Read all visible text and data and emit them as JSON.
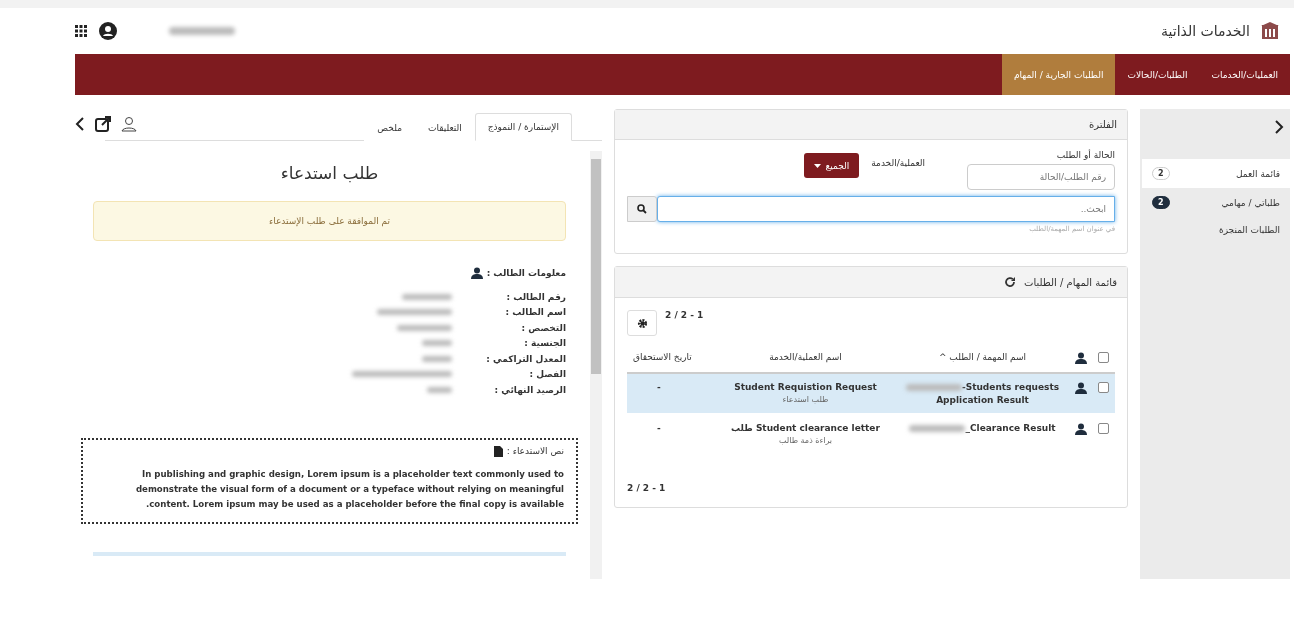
{
  "header": {
    "title": "الخدمات الذاتية"
  },
  "nav": [
    {
      "label": "العمليات/الخدمات",
      "selected": false
    },
    {
      "label": "الطلبات/الحالات",
      "selected": false
    },
    {
      "label": "الطلبات الجارية / المهام",
      "selected": true
    }
  ],
  "sidebar": {
    "items": [
      {
        "label": "قائمة العمل",
        "badge": "2",
        "selected": true
      },
      {
        "label": "طلباتي / مهامي",
        "badge": "2",
        "selected": false
      },
      {
        "label": "الطلبات المنجزة",
        "selected": false
      }
    ]
  },
  "filter": {
    "title": "الفلترة",
    "case_label": "الحالة أو الطلب",
    "case_placeholder": "رقم الطلب/الحالة",
    "service_label": "العملية/الخدمة",
    "service_value": "الجميع",
    "search_placeholder": "ابحث..",
    "search_hint": "في عنوان اسم المهمة/الطلب"
  },
  "tasks": {
    "title": "قائمة المهام / الطلبات",
    "pagination_top": "2 / 2 - 1",
    "pagination_bottom": "2 / 2 - 1",
    "select_all_checked": false,
    "columns": [
      "اسم المهمة / الطلب ^",
      "اسم العملية/الخدمة",
      "تاريخ الاستحقاق"
    ],
    "rows": [
      {
        "checked": false,
        "selected": true,
        "task": "Students requests-",
        "task_line2": "Application Result",
        "service": "Student Requistion Request",
        "service_sub": "طلب استدعاء",
        "due": "-"
      },
      {
        "checked": false,
        "selected": false,
        "task": "Clearance Result_",
        "service": "Student clearance letter طلب",
        "service_sub": "براءة ذمة طالب",
        "due": "-"
      }
    ]
  },
  "detail": {
    "tabs": [
      {
        "label": "الإستمارة / النموذج",
        "selected": true
      },
      {
        "label": "التعليقات",
        "selected": false
      },
      {
        "label": "ملخص",
        "selected": false
      }
    ],
    "title": "طلب استدعاء",
    "alert": "تم الموافقة على طلب الإستدعاء",
    "info_title": "معلومات الطالب :",
    "fields": [
      "رقم الطالب :",
      "اسم الطالب :",
      "التخصص :",
      "الجنسية :",
      "المعدل التراكمي :",
      "الفصل :",
      "الرصيد النهائي :"
    ],
    "text_title": "نص الاستدعاء :",
    "text": "In publishing and graphic design, Lorem ipsum is a placeholder text commonly used to demonstrate the visual form of a document or a typeface without relying on meaningful content. Lorem ipsum may be used as a placeholder before the final copy is available."
  }
}
